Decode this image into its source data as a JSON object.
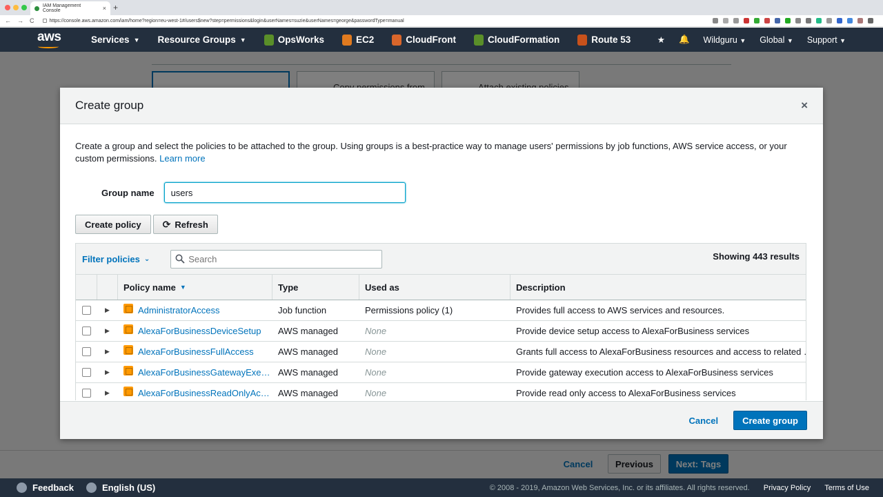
{
  "browser": {
    "tab_title": "IAM Management Console",
    "tab_close": "×",
    "new_tab": "+",
    "url": "https://console.aws.amazon.com/iam/home?region=eu-west-1#/users$new?step=permissions&login&userNames=suzie&userNames=george&passwordType=manual"
  },
  "nav": {
    "logo": "aws",
    "services": "Services",
    "resource_groups": "Resource Groups",
    "opsworks": "OpsWorks",
    "ec2": "EC2",
    "cloudfront": "CloudFront",
    "cloudformation": "CloudFormation",
    "route53": "Route 53",
    "account": "Wildguru",
    "region": "Global",
    "support": "Support"
  },
  "background": {
    "card_copy": "Copy permissions from",
    "card_attach": "Attach existing policies",
    "cancel": "Cancel",
    "previous": "Previous",
    "next": "Next: Tags"
  },
  "footer": {
    "feedback": "Feedback",
    "language": "English (US)",
    "copyright": "© 2008 - 2019, Amazon Web Services, Inc. or its affiliates. All rights reserved.",
    "privacy": "Privacy Policy",
    "terms": "Terms of Use"
  },
  "modal": {
    "title": "Create group",
    "close": "×",
    "intro": "Create a group and select the policies to be attached to the group. Using groups is a best-practice way to manage users' permissions by job functions, AWS service access, or your custom permissions.",
    "learn_more": "Learn more",
    "group_name_label": "Group name",
    "group_name_value": "users",
    "create_policy": "Create policy",
    "refresh": "Refresh",
    "filter_label": "Filter policies",
    "search_placeholder": "Search",
    "showing": "Showing 443 results",
    "columns": [
      "Policy name",
      "Type",
      "Used as",
      "Description"
    ],
    "rows": [
      {
        "name": "AdministratorAccess",
        "type": "Job function",
        "used_as": "Permissions policy (1)",
        "description": "Provides full access to AWS services and resources."
      },
      {
        "name": "AlexaForBusinessDeviceSetup",
        "type": "AWS managed",
        "used_as": "None",
        "description": "Provide device setup access to AlexaForBusiness services"
      },
      {
        "name": "AlexaForBusinessFullAccess",
        "type": "AWS managed",
        "used_as": "None",
        "description": "Grants full access to AlexaForBusiness resources and access to related …"
      },
      {
        "name": "AlexaForBusinessGatewayExe…",
        "type": "AWS managed",
        "used_as": "None",
        "description": "Provide gateway execution access to AlexaForBusiness services"
      },
      {
        "name": "AlexaForBusinessReadOnlyAc…",
        "type": "AWS managed",
        "used_as": "None",
        "description": "Provide read only access to AlexaForBusiness services"
      }
    ],
    "cancel": "Cancel",
    "create_group": "Create group"
  },
  "colors": {
    "nav_bg": "#232f3e",
    "accent": "#0073bb",
    "policy_icon": "#ff9900"
  }
}
